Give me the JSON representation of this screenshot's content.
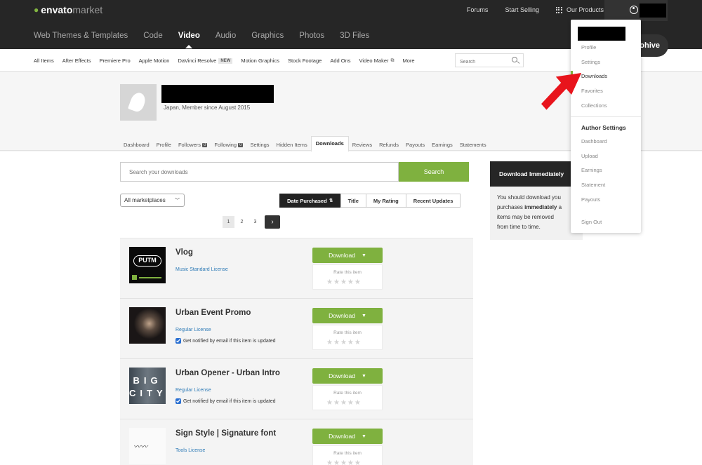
{
  "brand": {
    "name_bold": "envato",
    "name_light": "market"
  },
  "topnav": {
    "forums": "Forums",
    "start_selling": "Start Selling",
    "our_products": "Our Products"
  },
  "categories": [
    "Web Themes & Templates",
    "Code",
    "Video",
    "Audio",
    "Graphics",
    "Photos",
    "3D Files"
  ],
  "active_category": "Video",
  "subnav": {
    "items": [
      "All Items",
      "After Effects",
      "Premiere Pro",
      "Apple Motion",
      "DaVinci Resolve",
      "Motion Graphics",
      "Stock Footage",
      "Add Ons",
      "Video Maker",
      "More"
    ],
    "new_badge": "NEW",
    "search_placeholder": "Search"
  },
  "profile": {
    "member_since": "Japan, Member since August 2015",
    "tabs": [
      "Dashboard",
      "Profile",
      "Followers",
      "Following",
      "Settings",
      "Hidden Items",
      "Downloads",
      "Reviews",
      "Refunds",
      "Payouts",
      "Earnings",
      "Statements"
    ],
    "followers_count": "0",
    "following_count": "0",
    "active_tab": "Downloads"
  },
  "downloads": {
    "search_placeholder": "Search your downloads",
    "search_button": "Search",
    "marketplace_select": "All marketplaces",
    "sort_tabs": [
      "Date Purchased",
      "Title",
      "My Rating",
      "Recent Updates"
    ],
    "active_sort": "Date Purchased",
    "pages": [
      "1",
      "2",
      "3"
    ],
    "current_page": "1",
    "download_label": "Download",
    "rate_label": "Rate this item",
    "notify_label": "Get notified by email if this item is updated",
    "items": [
      {
        "title": "Vlog",
        "license": "Music Standard License",
        "notify": false,
        "thumb_text": "PUTM"
      },
      {
        "title": "Urban Event Promo",
        "license": "Regular License",
        "notify": true,
        "thumb_text": ""
      },
      {
        "title": "Urban Opener - Urban Intro",
        "license": "Regular License",
        "notify": true,
        "thumb_text": "BIG CITY"
      },
      {
        "title": "Sign Style | Signature font",
        "license": "Tools License",
        "notify": false,
        "thumb_text": ""
      }
    ]
  },
  "sidebar": {
    "title": "Download Immediately",
    "body_pre": "You should download you",
    "body_line2_pre": "purchases ",
    "body_strong": "immediately",
    "body_line2_post": " a",
    "body_line3": "items may be removed",
    "body_line4": "from time to time."
  },
  "account_menu": {
    "items": [
      "Profile",
      "Settings",
      "Downloads",
      "Favorites",
      "Collections"
    ],
    "current": "Downloads",
    "author_heading": "Author Settings",
    "author_items": [
      "Dashboard",
      "Upload",
      "Earnings",
      "Statement",
      "Payouts"
    ],
    "sign_out": "Sign Out"
  },
  "hive_pill_text": "ohive",
  "colors": {
    "topbar": "#262626",
    "accent_green": "#7fb13f",
    "link_blue": "#2d7ab6",
    "arrow_red": "#e8141c"
  }
}
